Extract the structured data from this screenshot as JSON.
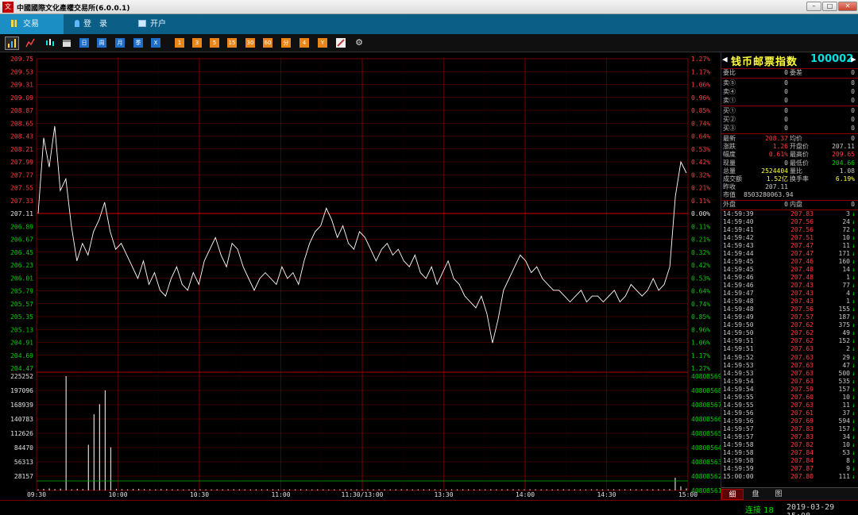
{
  "window": {
    "title": "中國國際文化產權交易所(6.0.0.1)",
    "logo_text": "文",
    "min_label": "–",
    "max_label": "□",
    "close_label": "✕"
  },
  "menu": {
    "tabs": [
      {
        "label": "交易",
        "icon": "chart-icon"
      },
      {
        "label": "登　录",
        "icon": "login-icon"
      },
      {
        "label": "开户",
        "icon": "account-icon"
      }
    ]
  },
  "toolbar": {
    "period_buttons": [
      "日",
      "周",
      "月",
      "季",
      "X"
    ],
    "minute_buttons": [
      "1",
      "3",
      "5",
      "15",
      "30",
      "60",
      "分",
      "4",
      "Y"
    ]
  },
  "chart_data": {
    "type": "line",
    "price_axis": {
      "ticks": [
        "209.75",
        "209.53",
        "209.31",
        "209.09",
        "208.87",
        "208.65",
        "208.43",
        "208.21",
        "207.99",
        "207.77",
        "207.55",
        "207.33",
        "207.11",
        "206.89",
        "206.67",
        "206.45",
        "206.23",
        "206.01",
        "205.79",
        "205.57",
        "205.35",
        "205.13",
        "204.91",
        "204.69",
        "204.47"
      ],
      "ylim": [
        204.47,
        209.75
      ],
      "reference": 207.11
    },
    "pct_axis": {
      "ticks": [
        "1.27%",
        "1.17%",
        "1.06%",
        "0.96%",
        "0.85%",
        "0.74%",
        "0.64%",
        "0.53%",
        "0.42%",
        "0.32%",
        "0.21%",
        "0.11%",
        "0.00%",
        "0.11%",
        "0.21%",
        "0.32%",
        "0.42%",
        "0.53%",
        "0.64%",
        "0.74%",
        "0.85%",
        "0.96%",
        "1.06%",
        "1.17%",
        "1.27%"
      ]
    },
    "volume_axis": {
      "ticks": [
        "225252",
        "197096",
        "168939",
        "140783",
        "112626",
        "84470",
        "56313",
        "28157"
      ],
      "ymax": 225252
    },
    "right_volume_axis": {
      "ticks": [
        "40808569",
        "40808568",
        "40808567",
        "40808566",
        "40808565",
        "40808564",
        "40808563",
        "40808562",
        "40808561"
      ]
    },
    "x_axis": {
      "ticks": [
        "09:30",
        "10:00",
        "10:30",
        "11:00",
        "11:30/13:00",
        "13:30",
        "14:00",
        "14:30",
        "15:00"
      ]
    },
    "price_series": [
      207.11,
      208.4,
      207.9,
      208.6,
      207.5,
      207.7,
      206.9,
      206.3,
      206.6,
      206.4,
      206.8,
      207.0,
      207.3,
      206.8,
      206.5,
      206.6,
      206.4,
      206.2,
      206.0,
      206.3,
      205.9,
      206.1,
      205.8,
      205.7,
      206.0,
      206.2,
      205.9,
      205.8,
      206.1,
      205.9,
      206.3,
      206.5,
      206.7,
      206.4,
      206.2,
      206.6,
      206.5,
      206.2,
      206.0,
      205.8,
      206.0,
      206.1,
      206.0,
      205.9,
      206.2,
      206.0,
      206.1,
      205.9,
      206.3,
      206.6,
      206.8,
      206.9,
      207.2,
      207.0,
      206.7,
      206.9,
      206.6,
      206.5,
      206.8,
      206.7,
      206.5,
      206.3,
      206.5,
      206.6,
      206.4,
      206.5,
      206.3,
      206.2,
      206.4,
      206.1,
      206.0,
      206.2,
      205.9,
      206.1,
      206.3,
      206.0,
      205.9,
      205.7,
      205.6,
      205.5,
      205.7,
      205.4,
      204.9,
      205.3,
      205.8,
      206.0,
      206.2,
      206.4,
      206.3,
      206.1,
      206.2,
      206.0,
      205.9,
      205.8,
      205.8,
      205.7,
      205.6,
      205.7,
      205.8,
      205.6,
      205.7,
      205.7,
      205.6,
      205.7,
      205.8,
      205.6,
      205.7,
      205.9,
      205.8,
      205.7,
      205.8,
      206.0,
      205.8,
      205.9,
      206.2,
      207.4,
      207.99,
      207.8
    ],
    "volume_series": [
      2000,
      3000,
      4000,
      2500,
      3500,
      225252,
      2000,
      3000,
      2500,
      90000,
      150000,
      170000,
      197096,
      85000,
      3000,
      2500,
      2000,
      2800,
      3000,
      2500,
      2200,
      2000,
      2600,
      2400,
      2200,
      2000,
      1800,
      2000,
      2200,
      2100,
      2000,
      1900,
      2100,
      2000,
      2200,
      2300,
      2100,
      2000,
      1900,
      2100,
      2000,
      2200,
      2100,
      2000,
      1900,
      2000,
      2100,
      2200,
      2000,
      1900,
      2100,
      2000,
      1800,
      1900,
      2000,
      2100,
      2200,
      2000,
      1900,
      2100,
      2000,
      2200,
      2100,
      2000,
      2100,
      2300,
      2200,
      2000,
      2100,
      2000,
      2200,
      2100,
      1900,
      2000,
      2100,
      2000,
      2200,
      2100,
      2000,
      1900,
      2100,
      2200,
      2000,
      2100,
      2200,
      2300,
      2100,
      2000,
      2200,
      2100,
      2000,
      1900,
      2000,
      2100,
      2200,
      2000,
      2100,
      2000,
      1900,
      2100,
      2200,
      2000,
      2100,
      2200,
      2000,
      2100,
      2300,
      2200,
      2100,
      2000,
      2200,
      2400,
      2300,
      2500,
      25000,
      8000,
      4000
    ]
  },
  "side": {
    "name": "钱币邮票指数",
    "code": "100002",
    "book": [
      {
        "label": "委比",
        "value": "0",
        "label2": "委差",
        "value2": "0"
      },
      {
        "label": "卖⑤",
        "value": "0",
        "value2": "0"
      },
      {
        "label": "卖④",
        "value": "0",
        "value2": "0"
      },
      {
        "label": "卖①",
        "value": "0",
        "value2": "0"
      },
      {
        "label": "买①",
        "value": "0",
        "value2": "0"
      },
      {
        "label": "买②",
        "value": "0",
        "value2": "0"
      },
      {
        "label": "买③",
        "value": "0",
        "value2": "0"
      }
    ],
    "stats": [
      {
        "label": "最新",
        "value": "208.37",
        "vc": "r",
        "label2": "均价",
        "value2": "0",
        "vc2": "w"
      },
      {
        "label": "涨跌",
        "value": "1.26",
        "vc": "r",
        "label2": "开盘价",
        "value2": "207.11",
        "vc2": "w"
      },
      {
        "label": "幅度",
        "value": "0.61%",
        "vc": "r",
        "label2": "最高价",
        "value2": "209.65",
        "vc2": "r"
      },
      {
        "label": "现量",
        "value": "0",
        "vc": "w",
        "label2": "最低价",
        "value2": "204.66",
        "vc2": "g"
      },
      {
        "label": "总量",
        "value": "2524404",
        "vc": "y",
        "label2": "量比",
        "value2": "1.08",
        "vc2": "w"
      },
      {
        "label": "成交额",
        "value": "1.52亿",
        "vc": "y",
        "label2": "换手率",
        "value2": "6.19%",
        "vc2": "y"
      },
      {
        "label": "昨收",
        "value": "207.11",
        "vc": "w",
        "label2": "",
        "value2": "",
        "vc2": "w"
      },
      {
        "label": "市值",
        "value": "8503280063.94",
        "vc": "w",
        "label2": "",
        "value2": "",
        "vc2": "w"
      }
    ],
    "outer": {
      "label": "外盘",
      "value": "0",
      "label2": "内盘",
      "value2": "0"
    },
    "ticks": [
      {
        "time": "14:59:39",
        "price": "207.83",
        "vol": "3",
        "dir": "↓"
      },
      {
        "time": "14:59:40",
        "price": "207.56",
        "vol": "24",
        "dir": "↓"
      },
      {
        "time": "14:59:41",
        "price": "207.56",
        "vol": "72",
        "dir": "↓"
      },
      {
        "time": "14:59:42",
        "price": "207.51",
        "vol": "10",
        "dir": "↓"
      },
      {
        "time": "14:59:43",
        "price": "207.47",
        "vol": "11",
        "dir": "↓"
      },
      {
        "time": "14:59:44",
        "price": "207.47",
        "vol": "171",
        "dir": "↓"
      },
      {
        "time": "14:59:45",
        "price": "207.46",
        "vol": "160",
        "dir": "↓"
      },
      {
        "time": "14:59:45",
        "price": "207.48",
        "vol": "14",
        "dir": "↓"
      },
      {
        "time": "14:59:46",
        "price": "207.48",
        "vol": "1",
        "dir": "↓"
      },
      {
        "time": "14:59:46",
        "price": "207.43",
        "vol": "77",
        "dir": "↓"
      },
      {
        "time": "14:59:47",
        "price": "207.43",
        "vol": "4",
        "dir": "↓"
      },
      {
        "time": "14:59:48",
        "price": "207.43",
        "vol": "1",
        "dir": "↓"
      },
      {
        "time": "14:59:48",
        "price": "207.56",
        "vol": "155",
        "dir": "↓"
      },
      {
        "time": "14:59:49",
        "price": "207.57",
        "vol": "187",
        "dir": "↓"
      },
      {
        "time": "14:59:50",
        "price": "207.62",
        "vol": "375",
        "dir": "↓"
      },
      {
        "time": "14:59:50",
        "price": "207.62",
        "vol": "49",
        "dir": "↓"
      },
      {
        "time": "14:59:51",
        "price": "207.62",
        "vol": "152",
        "dir": "↓"
      },
      {
        "time": "14:59:51",
        "price": "207.63",
        "vol": "2",
        "dir": "↓"
      },
      {
        "time": "14:59:52",
        "price": "207.63",
        "vol": "29",
        "dir": "↓"
      },
      {
        "time": "14:59:53",
        "price": "207.63",
        "vol": "47",
        "dir": "↓"
      },
      {
        "time": "14:59:53",
        "price": "207.63",
        "vol": "500",
        "dir": "↓"
      },
      {
        "time": "14:59:54",
        "price": "207.63",
        "vol": "535",
        "dir": "↓"
      },
      {
        "time": "14:59:54",
        "price": "207.59",
        "vol": "157",
        "dir": "↓"
      },
      {
        "time": "14:59:55",
        "price": "207.60",
        "vol": "10",
        "dir": "↓"
      },
      {
        "time": "14:59:55",
        "price": "207.63",
        "vol": "11",
        "dir": "↓"
      },
      {
        "time": "14:59:56",
        "price": "207.61",
        "vol": "37",
        "dir": "↓"
      },
      {
        "time": "14:59:56",
        "price": "207.69",
        "vol": "594",
        "dir": "↓"
      },
      {
        "time": "14:59:57",
        "price": "207.83",
        "vol": "157",
        "dir": "↓"
      },
      {
        "time": "14:59:57",
        "price": "207.83",
        "vol": "34",
        "dir": "↓"
      },
      {
        "time": "14:59:58",
        "price": "207.82",
        "vol": "10",
        "dir": "↓"
      },
      {
        "time": "14:59:58",
        "price": "207.84",
        "vol": "53",
        "dir": "↓"
      },
      {
        "time": "14:59:58",
        "price": "207.84",
        "vol": "8",
        "dir": "↓"
      },
      {
        "time": "14:59:59",
        "price": "207.87",
        "vol": "9",
        "dir": "↓"
      },
      {
        "time": "15:00:00",
        "price": "207.80",
        "vol": "111",
        "dir": "↓"
      }
    ],
    "tabs": [
      "细",
      "盘",
      "图"
    ]
  },
  "status": {
    "connection": "连接 18",
    "datetime": "2019-03-29 15:08"
  },
  "colors": {
    "grid": "#7a0000",
    "price_line": "#ffffff",
    "volume_bar": "#d8d8d0",
    "up": "#ff3c3c",
    "down": "#00d000"
  }
}
